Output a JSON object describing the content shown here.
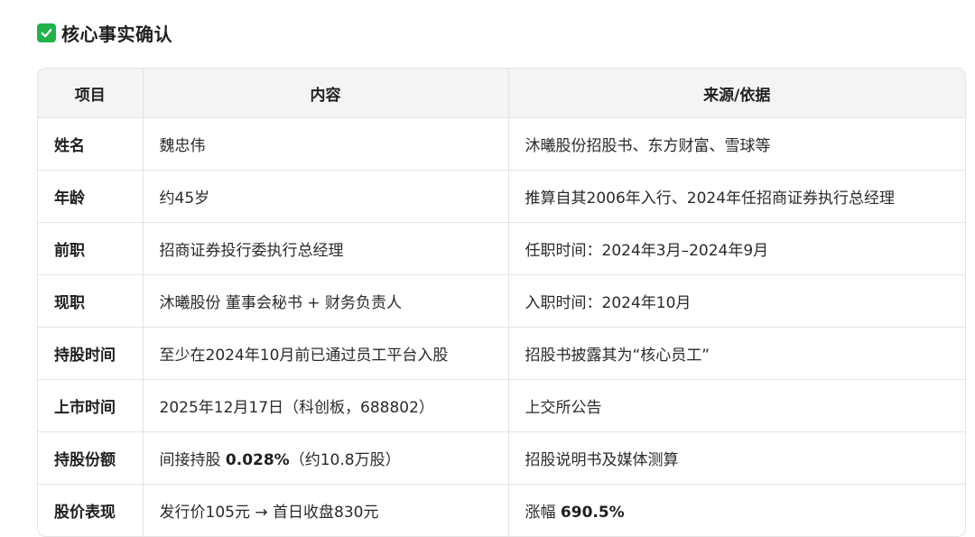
{
  "heading": {
    "icon": "check-mark-icon",
    "icon_color": "#22b24c",
    "title": "核心事实确认"
  },
  "table": {
    "headers": [
      "项目",
      "内容",
      "来源/依据"
    ],
    "rows": [
      {
        "key": "姓名",
        "content": {
          "pre": "魏忠伟",
          "bold": "",
          "post": ""
        },
        "source": {
          "pre": "沐曦股份招股书、东方财富、雪球等",
          "bold": "",
          "post": ""
        }
      },
      {
        "key": "年龄",
        "content": {
          "pre": "约45岁",
          "bold": "",
          "post": ""
        },
        "source": {
          "pre": "推算自其2006年入行、2024年任招商证券执行总经理",
          "bold": "",
          "post": ""
        }
      },
      {
        "key": "前职",
        "content": {
          "pre": "招商证券投行委执行总经理",
          "bold": "",
          "post": ""
        },
        "source": {
          "pre": "任职时间：2024年3月–2024年9月",
          "bold": "",
          "post": ""
        }
      },
      {
        "key": "现职",
        "content": {
          "pre": "沐曦股份 董事会秘书 + 财务负责人",
          "bold": "",
          "post": ""
        },
        "source": {
          "pre": "入职时间：2024年10月",
          "bold": "",
          "post": ""
        }
      },
      {
        "key": "持股时间",
        "content": {
          "pre": "至少在2024年10月前已通过员工平台入股",
          "bold": "",
          "post": ""
        },
        "source": {
          "pre": "招股书披露其为“核心员工”",
          "bold": "",
          "post": ""
        }
      },
      {
        "key": "上市时间",
        "content": {
          "pre": "2025年12月17日（科创板，688802）",
          "bold": "",
          "post": ""
        },
        "source": {
          "pre": "上交所公告",
          "bold": "",
          "post": ""
        }
      },
      {
        "key": "持股份额",
        "content": {
          "pre": "间接持股 ",
          "bold": "0.028%",
          "post": "（约10.8万股）"
        },
        "source": {
          "pre": "招股说明书及媒体测算",
          "bold": "",
          "post": ""
        }
      },
      {
        "key": "股价表现",
        "content": {
          "pre": "发行价105元 → 首日收盘830元",
          "bold": "",
          "post": ""
        },
        "source": {
          "pre": "涨幅 ",
          "bold": "690.5%",
          "post": ""
        }
      }
    ]
  }
}
